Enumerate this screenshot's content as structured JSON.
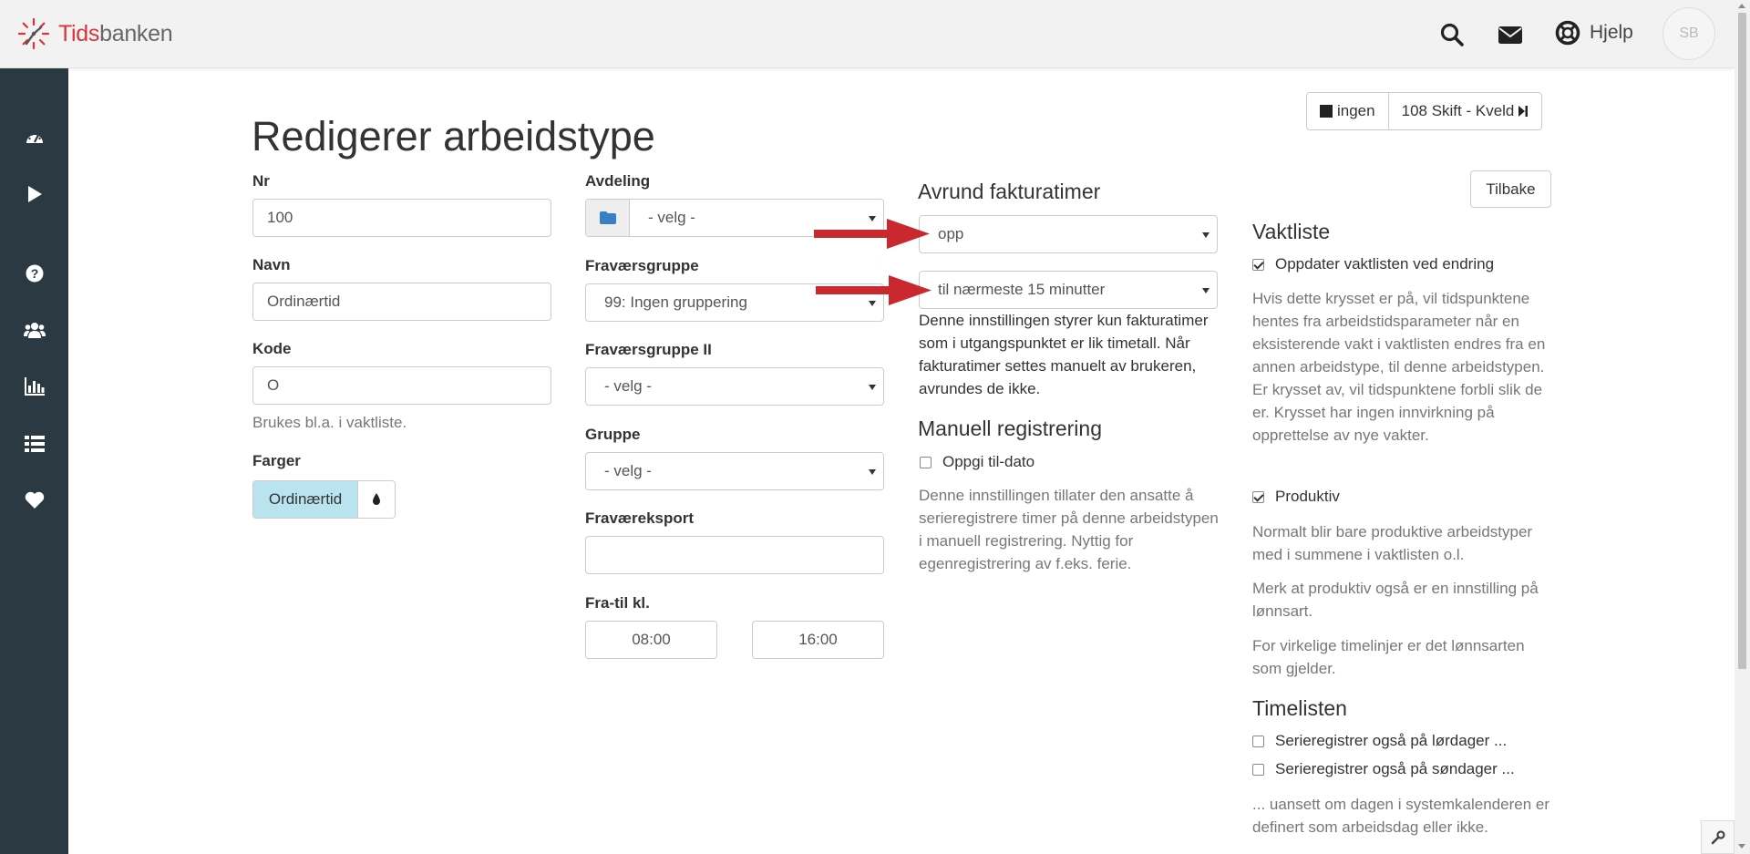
{
  "header": {
    "brand_red": "Tids",
    "brand_grey": "banken",
    "help_label": "Hjelp",
    "avatar_initials": "SB",
    "icons": [
      "search-icon",
      "mail-icon",
      "lifebuoy-icon"
    ]
  },
  "sidebar": {
    "items": [
      "dashboard-icon",
      "play-icon",
      "help-icon",
      "users-icon",
      "chart-icon",
      "list-icon",
      "heart-icon"
    ]
  },
  "page": {
    "title": "Redigerer arbeidstype",
    "nav_none_label": "ingen",
    "nav_next_label": "108 Skift - Kveld",
    "back_label": "Tilbake"
  },
  "form": {
    "nr_label": "Nr",
    "nr_value": "100",
    "navn_label": "Navn",
    "navn_value": "Ordinærtid",
    "kode_label": "Kode",
    "kode_value": "O",
    "kode_help": "Brukes bl.a. i vaktliste.",
    "farger_label": "Farger",
    "farger_value": "Ordinærtid",
    "avdeling_label": "Avdeling",
    "avdeling_value": "- velg -",
    "fravaersgruppe_label": "Fraværsgruppe",
    "fravaersgruppe_value": "99: Ingen gruppering",
    "fravaersgruppe2_label": "Fraværsgruppe II",
    "fravaersgruppe2_value": "- velg -",
    "gruppe_label": "Gruppe",
    "gruppe_value": "- velg -",
    "fravaereksport_label": "Fraværeksport",
    "fravaereksport_value": "",
    "fratil_label": "Fra-til kl.",
    "fra_value": "08:00",
    "til_value": "16:00"
  },
  "rounding": {
    "title": "Avrund fakturatimer",
    "direction_value": "opp",
    "interval_value": "til nærmeste 15 minutter",
    "help": "Denne innstillingen styrer kun fakturatimer som i utgangspunktet er lik timetall. Når fakturatimer settes manuelt av brukeren, avrundes de ikke."
  },
  "manual": {
    "title": "Manuell registrering",
    "checkbox_label": "Oppgi til-dato",
    "checkbox_checked": false,
    "help": "Denne innstillingen tillater den ansatte å serieregistrere timer på denne arbeidstypen i manuell registrering. Nyttig for egenregistrering av f.eks. ferie."
  },
  "vaktliste": {
    "title": "Vaktliste",
    "update_label": "Oppdater vaktlisten ved endring",
    "update_checked": true,
    "update_help": "Hvis dette krysset er på, vil tidspunktene hentes fra arbeidstidsparameter når en eksisterende vakt i vaktlisten endres fra en annen arbeidstype, til denne arbeidstypen. Er krysset av, vil tidspunktene forbli slik de er. Krysset har ingen innvirkning på opprettelse av nye vakter.",
    "produktiv_label": "Produktiv",
    "produktiv_checked": true,
    "produktiv_help1": "Normalt blir bare produktive arbeidstyper med i summene i vaktlisten o.l.",
    "produktiv_help2": "Merk at produktiv også er en innstilling på lønnsart.",
    "produktiv_help3": "For virkelige timelinjer er det lønnsarten som gjelder."
  },
  "timelisten": {
    "title": "Timelisten",
    "saturday_label": "Serieregistrer også på lørdager ...",
    "saturday_checked": false,
    "sunday_label": "Serieregistrer også på søndager ...",
    "sunday_checked": false,
    "help": "... uansett om dagen i systemkalenderen er definert som arbeidsdag eller ikke."
  },
  "colors": {
    "brand_red": "#d9343b",
    "sidebar_bg": "#2b3942",
    "color_chip": "#b9e3ef",
    "arrow_red": "#c8282e",
    "folder_blue": "#3a7fc4"
  }
}
